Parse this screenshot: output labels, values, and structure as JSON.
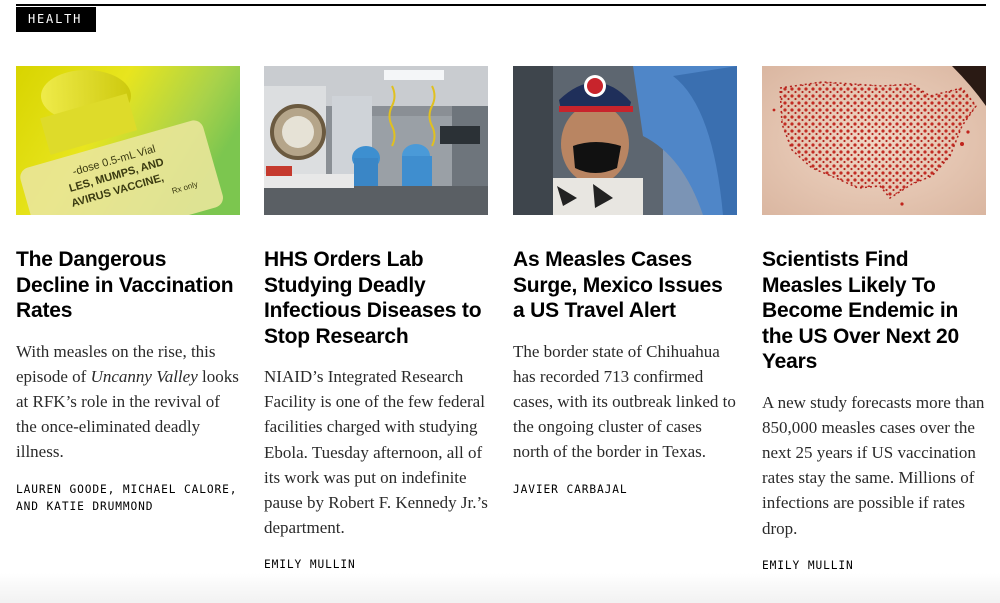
{
  "section": {
    "label": "HEALTH"
  },
  "cards": [
    {
      "title": "The Dangerous Decline in Vaccination Rates",
      "dek_before": "With measles on the rise, this episode of ",
      "dek_italic": "Uncanny Valley",
      "dek_after": " looks at RFK’s role in the revival of the once-eliminated deadly illness.",
      "byline_1": "LAUREN GOODE, MICHAEL CALORE,",
      "byline_2": "AND KATIE DRUMMOND",
      "image": {
        "icon": "vaccine-vial-image",
        "vial_text_1": "-dose 0.5-mL Vial",
        "vial_text_2": "LES, MUMPS, AND",
        "vial_text_3": "AVIRUS VACCINE,",
        "vial_text_4": "Rx only"
      }
    },
    {
      "title": "HHS Orders Lab Studying Deadly Infectious Diseases to Stop Research",
      "dek": "NIAID’s Integrated Research Facility is one of the few federal facilities charged with studying Ebola. Tuesday afternoon, all of its work was put on indefinite pause by Robert F. Kennedy Jr.’s department.",
      "byline": "EMILY MULLIN",
      "image": {
        "icon": "lab-image"
      }
    },
    {
      "title": "As Measles Cases Surge, Mexico Issues a US Travel Alert",
      "dek": "The border state of Chihuahua has recorded 713 confirmed cases, with its outbreak linked to the ongoing cluster of cases north of the border in Texas.",
      "byline": "JAVIER CARBAJAL",
      "image": {
        "icon": "boy-vaccination-image"
      }
    },
    {
      "title": "Scientists Find Measles Likely To Become Endemic in the US Over Next 20 Years",
      "dek": "A new study forecasts more than 850,000 measles cases over the next 25 years if US vaccination rates stay the same. Millions of infections are possible if rates drop.",
      "byline": "EMILY MULLIN",
      "image": {
        "icon": "us-map-rash-image"
      }
    }
  ],
  "colors": {
    "tag_bg": "#000000",
    "tag_text": "#ffffff",
    "rash": "#c0241c",
    "vial": "#e6e21a"
  }
}
